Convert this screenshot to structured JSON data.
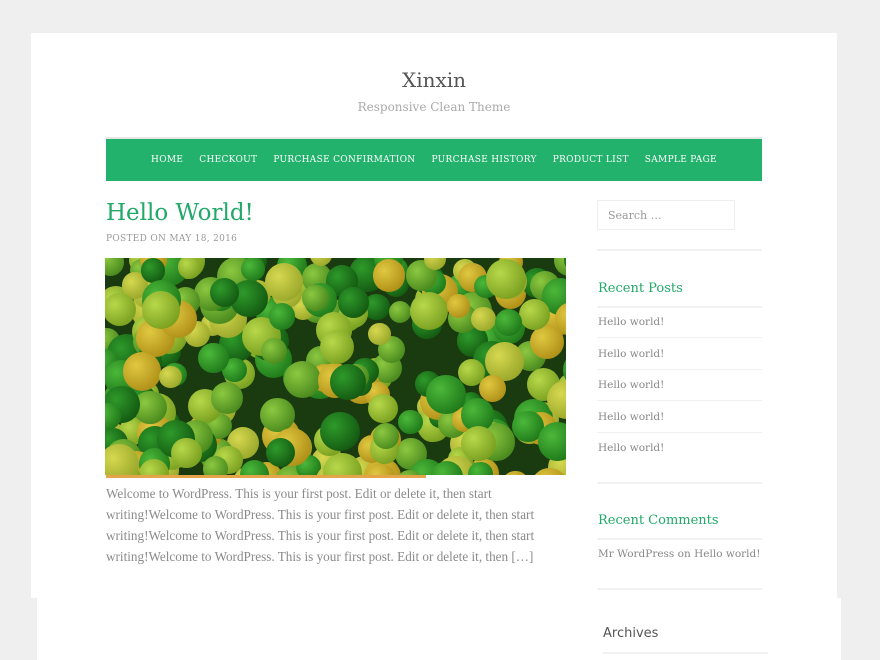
{
  "site": {
    "title": "Xinxin",
    "tagline": "Responsive Clean Theme"
  },
  "nav": [
    "HOME",
    "CHECKOUT",
    "PURCHASE CONFIRMATION",
    "PURCHASE HISTORY",
    "PRODUCT LIST",
    "SAMPLE PAGE"
  ],
  "post": {
    "title": "Hello World!",
    "meta": "POSTED ON MAY 18, 2016",
    "excerpt": "Welcome to WordPress. This is your first post. Edit or delete it, then start writing!Welcome to WordPress. This is your first post. Edit or delete it, then start writing!Welcome to WordPress. This is your first post. Edit or delete it, then start writing!Welcome to WordPress. This is your first post. Edit or delete it, then […]"
  },
  "sidebar": {
    "search_placeholder": "Search …",
    "recent_posts_title": "Recent Posts",
    "recent_posts": [
      "Hello world!",
      "Hello world!",
      "Hello world!",
      "Hello world!",
      "Hello world!"
    ],
    "recent_comments_title": "Recent Comments",
    "comment": {
      "author": "Mr WordPress",
      "on": "on",
      "post": "Hello world!"
    },
    "archives_title": "Archives"
  },
  "colors": {
    "accent": "#22b26c",
    "link": "#22a868"
  }
}
